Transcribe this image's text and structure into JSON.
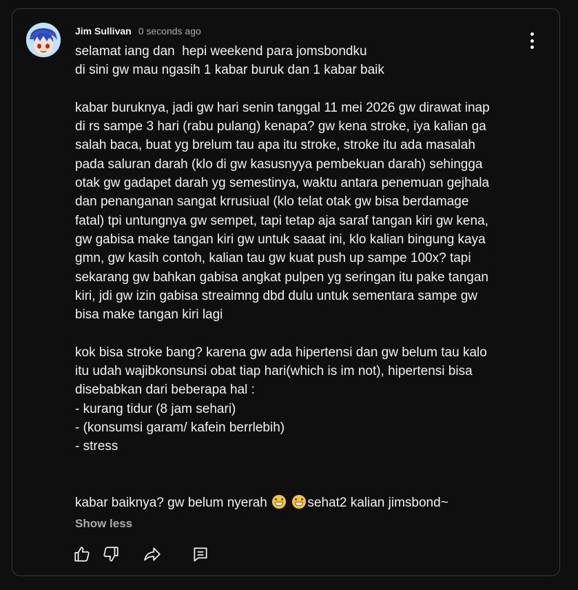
{
  "comment": {
    "author": "Jim Sullivan",
    "timestamp": "0 seconds ago",
    "lines": [
      "selamat iang dan  hepi weekend para jomsbondku",
      "di sini gw mau ngasih 1 kabar buruk dan 1 kabar baik",
      "",
      "kabar buruknya, jadi gw hari senin tanggal 11 mei 2026 gw dirawat inap",
      "di rs sampe 3 hari (rabu pulang) kenapa? gw kena stroke, iya kalian ga",
      "salah baca, buat yg brelum tau apa itu stroke, stroke itu ada masalah",
      "pada saluran darah (klo di gw kasusnyya pembekuan darah) sehingga",
      "otak gw gadapet darah yg semestinya, waktu antara penemuan gejhala",
      "dan penanganan sangat krrusiual (klo telat otak gw bisa berdamage",
      "fatal) tpi untungnya gw sempet, tapi tetap aja saraf tangan kiri gw kena,",
      "gw gabisa make tangan kiri gw untuk saaat ini, klo kalian bingung kaya",
      "gmn, gw kasih contoh, kalian tau gw kuat push up sampe 100x? tapi",
      "sekarang gw bahkan gabisa angkat pulpen yg seringan itu pake tangan",
      "kiri, jdi gw izin gabisa streaimng dbd dulu untuk sementara sampe gw",
      "bisa make tangan kiri lagi",
      "",
      "kok bisa stroke bang? karena gw ada hipertensi dan gw belum tau kalo",
      "itu udah wajibkonsunsi obat tiap hari(which is im not), hipertensi bisa",
      "disebabkan dari beberapa hal :",
      "- kurang tidur (8 jam sehari)",
      "- (konsumsi garam/ kafein berrlebih)",
      "- stress",
      "",
      ""
    ],
    "last_line_start": "kabar baiknya? gw belum nyerah",
    "last_line_end": "sehat2 kalian jimsbond~",
    "emoji": "grinning-face-emoji",
    "show_less_label": "Show less"
  },
  "icons": {
    "menu": "more-vertical-icon",
    "like": "thumbs-up-icon",
    "dislike": "thumbs-down-icon",
    "share": "share-icon",
    "reply": "reply-icon"
  },
  "colors": {
    "background": "#0f0f0f",
    "border": "#3a3a3a",
    "text": "#f1f1f1",
    "muted": "#aaaaaa"
  }
}
